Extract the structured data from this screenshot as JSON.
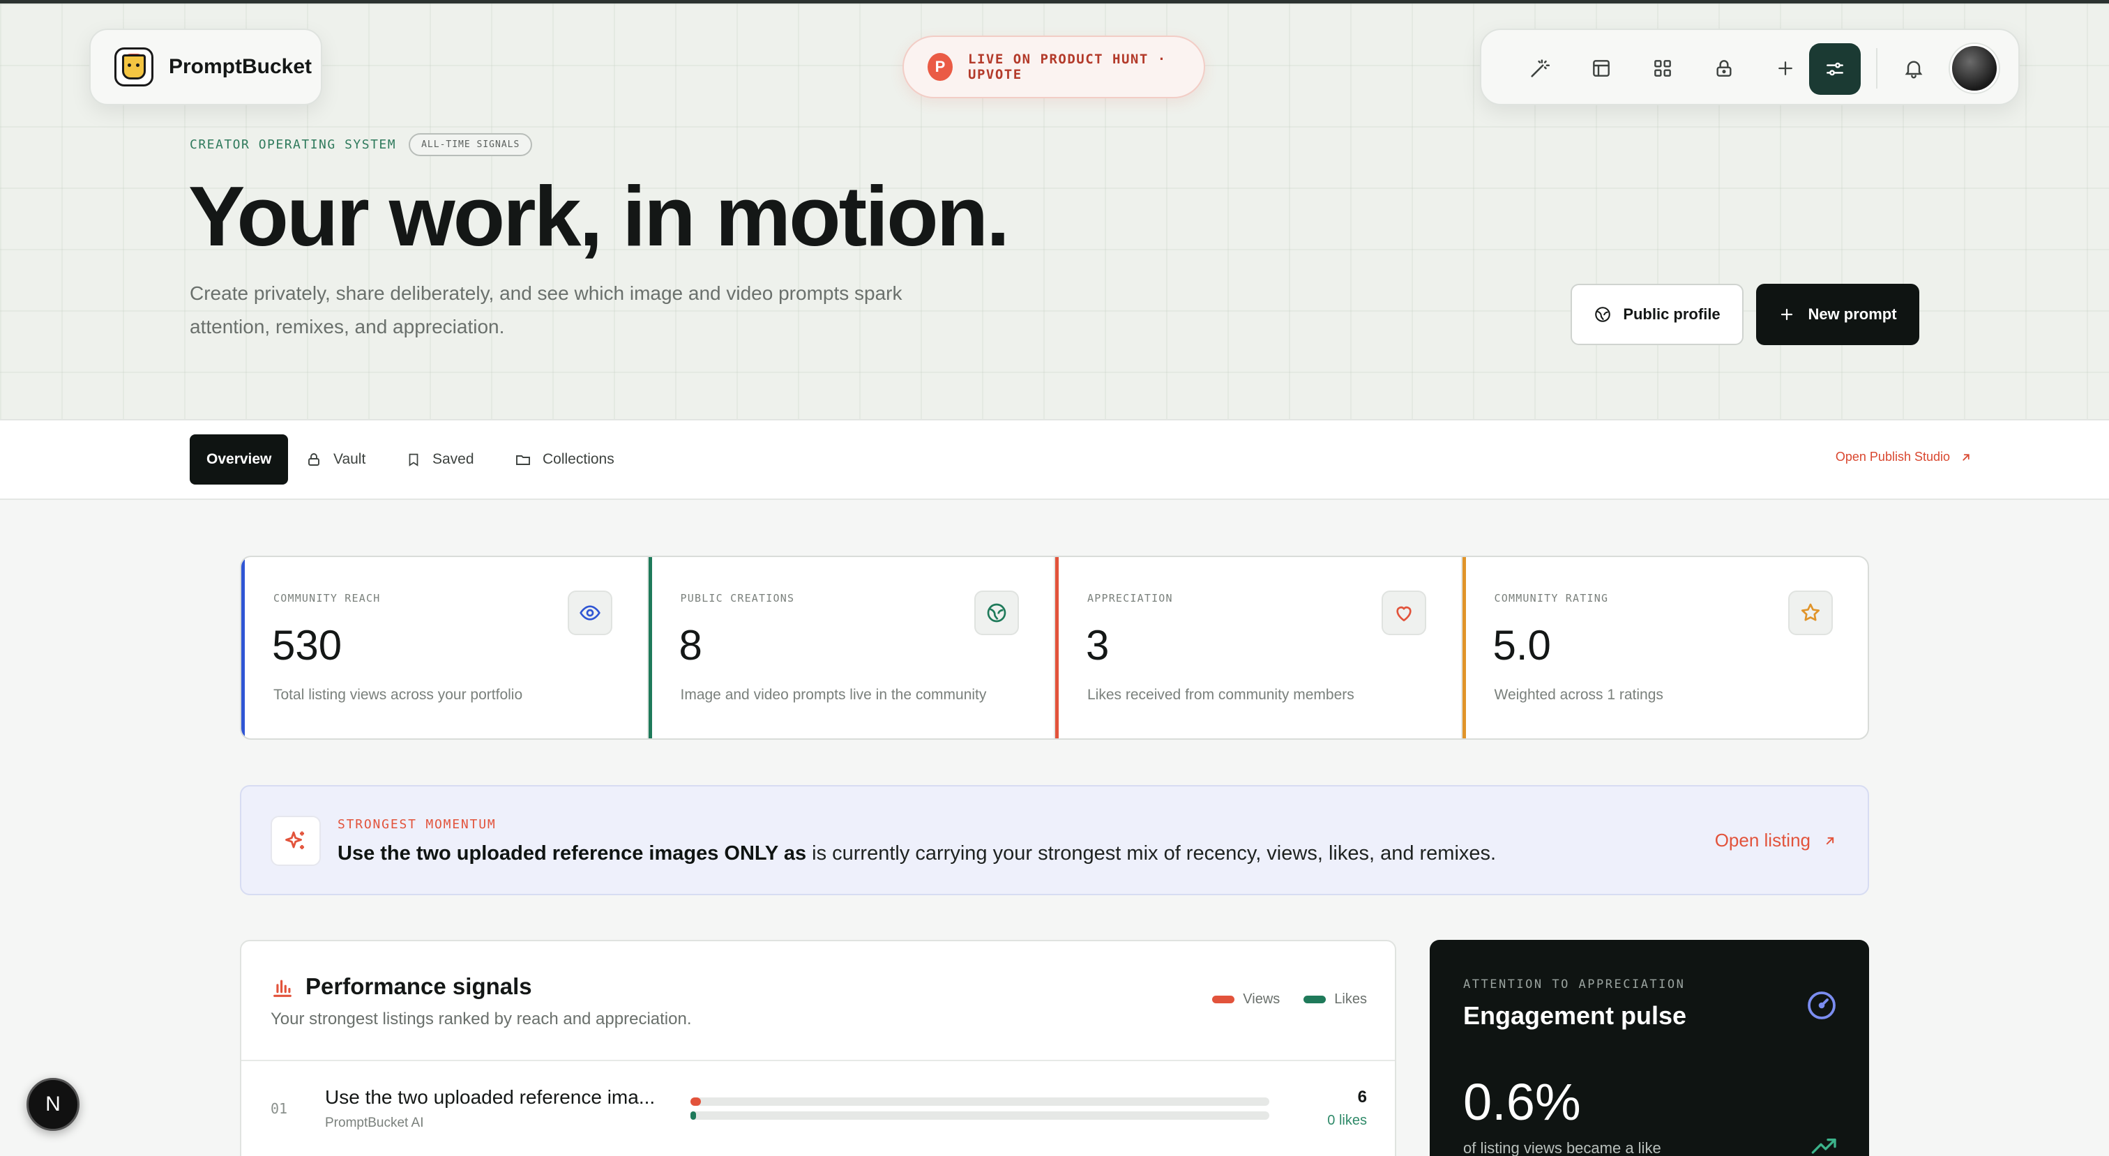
{
  "brand": {
    "name": "PromptBucket"
  },
  "banner": {
    "badge": "P",
    "text": "LIVE ON PRODUCT HUNT · UPVOTE"
  },
  "toolbar": {
    "icons": [
      "magic-wand-icon",
      "layout-icon",
      "grid-icon",
      "lock-icon",
      "plus-icon",
      "sliders-icon",
      "bell-icon"
    ],
    "active": "sliders-icon"
  },
  "hero": {
    "eyebrow": "CREATOR OPERATING SYSTEM",
    "chip": "ALL-TIME SIGNALS",
    "title": "Your work, in motion.",
    "subtitle": "Create privately, share deliberately, and see which image and video prompts spark attention, remixes, and appreciation.",
    "public_profile_label": "Public profile",
    "new_prompt_label": "New prompt"
  },
  "tabs": [
    {
      "label": "Overview",
      "active": true
    },
    {
      "label": "Vault"
    },
    {
      "label": "Saved"
    },
    {
      "label": "Collections"
    }
  ],
  "publish_link": "Open Publish Studio",
  "stats": [
    {
      "label": "COMMUNITY REACH",
      "value": "530",
      "desc": "Total listing views across your portfolio",
      "accent": "#2f55d4",
      "icon": "eye-icon"
    },
    {
      "label": "PUBLIC CREATIONS",
      "value": "8",
      "desc": "Image and video prompts live in the community",
      "accent": "#1f7a5a",
      "icon": "globe-icon"
    },
    {
      "label": "APPRECIATION",
      "value": "3",
      "desc": "Likes received from community members",
      "accent": "#e2533b",
      "icon": "heart-icon"
    },
    {
      "label": "COMMUNITY RATING",
      "value": "5.0",
      "desc": "Weighted across 1 ratings",
      "accent": "#e0942a",
      "icon": "star-icon"
    }
  ],
  "momentum": {
    "eyebrow": "STRONGEST MOMENTUM",
    "highlight": "Use the two uploaded reference images ONLY as",
    "rest": " is currently carrying your strongest mix of recency, views, likes, and remixes.",
    "link": "Open listing"
  },
  "performance": {
    "title": "Performance signals",
    "subtitle": "Your strongest listings ranked by reach and appreciation.",
    "legend": [
      {
        "label": "Views",
        "color": "#e2533b"
      },
      {
        "label": "Likes",
        "color": "#1f7a5a"
      }
    ],
    "rows": [
      {
        "index": "01",
        "title": "Use the two uploaded reference ima...",
        "author": "PromptBucket AI",
        "views": "6",
        "likes": "0 likes",
        "views_fraction": 0.018,
        "likes_fraction": 0.01
      }
    ]
  },
  "pulse": {
    "eyebrow": "ATTENTION TO APPRECIATION",
    "title": "Engagement pulse",
    "value": "0.6%",
    "note": "of listing views became a like"
  },
  "n_badge": "N"
}
